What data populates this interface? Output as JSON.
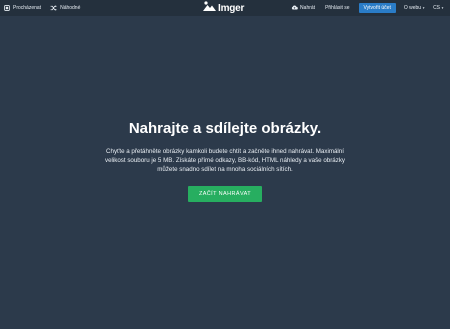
{
  "topbar": {
    "explore_label": "Procházenat",
    "random_label": "Náhodné",
    "brand_name": "Imger",
    "upload_label": "Nahrát",
    "login_label": "Přihlásit se",
    "create_account_label": "Vytvořit účet",
    "about_label": "O webu",
    "language_label": "CS",
    "icons": {
      "explore": "explore-icon",
      "random": "shuffle-icon",
      "upload": "cloud-upload-icon",
      "logo": "mountain-logo-icon"
    }
  },
  "hero": {
    "title": "Nahrajte a sdílejte obrázky.",
    "description": "Chyťte a přetáhněte obrázky kamkoli budete chtít a začněte ihned nahrávat. Maximální velikost souboru je 5 MB. Získáte přímé odkazy, BB-kód, HTML náhledy a vaše obrázky můžete snadno sdílet na mnoha sociálních sítích.",
    "button_label": "ZAČÍT NAHRÁVAT"
  },
  "colors": {
    "background": "#2c3a4b",
    "topbar": "#24303d",
    "primary_button": "#2a7cc7",
    "start_button": "#27ae60"
  }
}
